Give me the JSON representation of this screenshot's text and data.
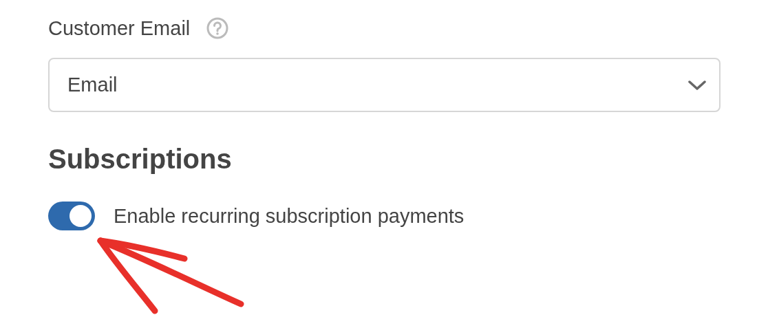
{
  "field": {
    "label": "Customer Email",
    "value": "Email"
  },
  "section": {
    "title": "Subscriptions"
  },
  "toggle": {
    "label": "Enable recurring subscription payments",
    "on": true
  }
}
